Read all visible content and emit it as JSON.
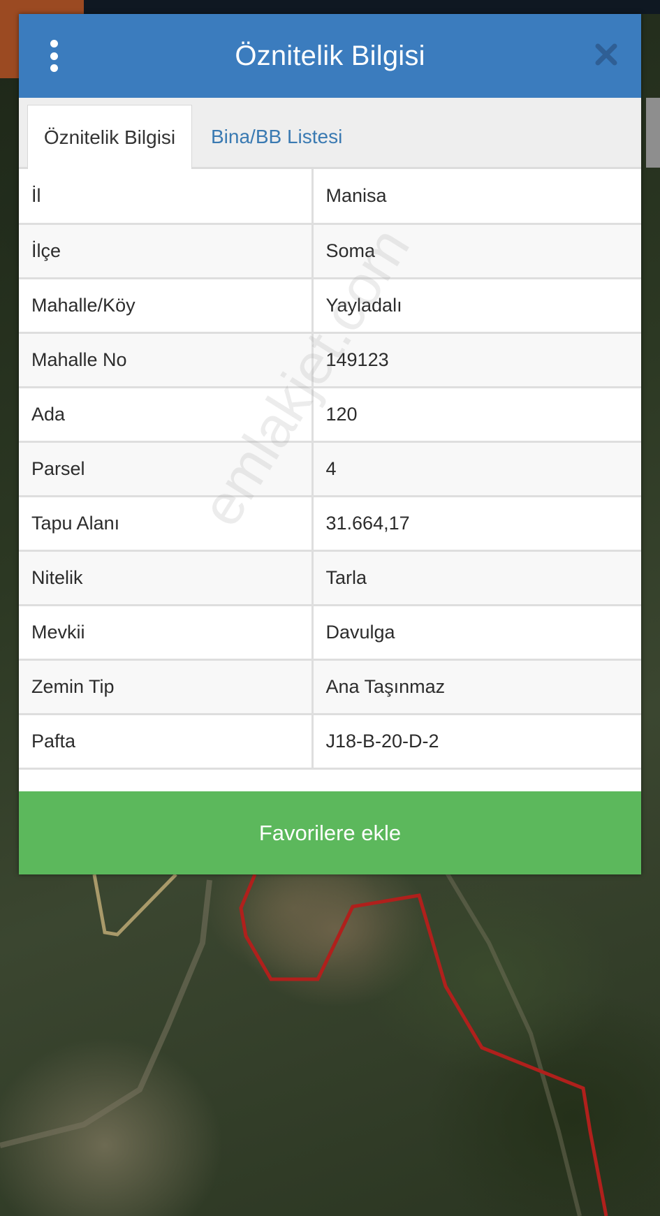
{
  "dialog": {
    "title": "Öznitelik Bilgisi",
    "menu_icon": "vertical-dots-icon",
    "close_icon": "close-x-icon"
  },
  "tabs": [
    {
      "label": "Öznitelik Bilgisi",
      "active": true
    },
    {
      "label": "Bina/BB Listesi",
      "active": false
    }
  ],
  "attributes": [
    {
      "key": "İl",
      "value": "Manisa"
    },
    {
      "key": "İlçe",
      "value": "Soma"
    },
    {
      "key": "Mahalle/Köy",
      "value": "Yayladalı"
    },
    {
      "key": "Mahalle No",
      "value": "149123"
    },
    {
      "key": "Ada",
      "value": "120"
    },
    {
      "key": "Parsel",
      "value": "4"
    },
    {
      "key": "Tapu Alanı",
      "value": "31.664,17"
    },
    {
      "key": "Nitelik",
      "value": "Tarla"
    },
    {
      "key": "Mevkii",
      "value": "Davulga"
    },
    {
      "key": "Zemin Tip",
      "value": "Ana Taşınmaz"
    },
    {
      "key": "Pafta",
      "value": "J18-B-20-D-2"
    }
  ],
  "favorite_button": {
    "label": "Favorilere ekle"
  },
  "watermark": "emlakjet.com",
  "colors": {
    "header": "#3b7cbe",
    "button": "#5cb85c",
    "parcel_border": "#b0201c",
    "tab_link": "#3a7ab2"
  }
}
